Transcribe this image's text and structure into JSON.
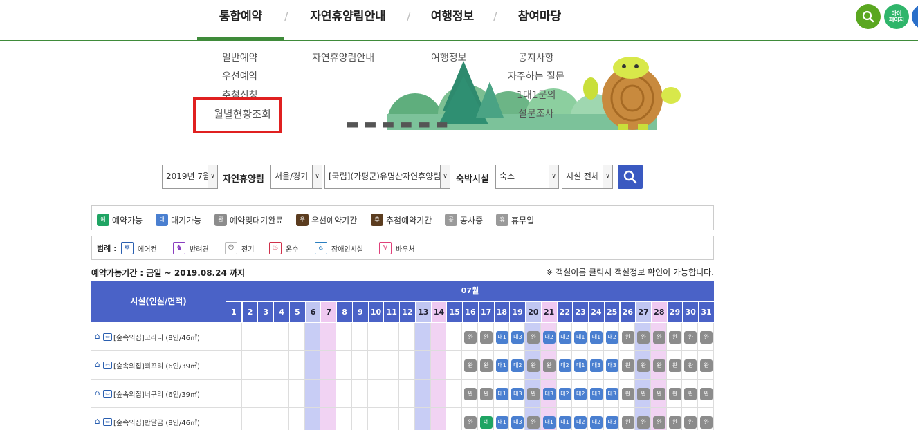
{
  "gnb": {
    "items": [
      {
        "label": "통합예약",
        "active": true
      },
      {
        "label": "자연휴양림안내",
        "active": false
      },
      {
        "label": "여행정보",
        "active": false
      },
      {
        "label": "참여마당",
        "active": false
      }
    ],
    "separator": "/",
    "mypage_label": "마이\n페이지"
  },
  "submenu": {
    "reservation": [
      "일반예약",
      "우선예약",
      "추첨신청",
      "월별현황조회"
    ],
    "forest": [
      "자연휴양림안내"
    ],
    "travel": [
      "여행정보"
    ],
    "community": [
      "공지사항",
      "자주하는 질문",
      "1대1문의",
      "설문조사"
    ]
  },
  "filters": {
    "month": "2019년 7월",
    "forest_label": "자연휴양림",
    "region": "서울/경기",
    "forest": "[국립](가평군)유명산자연휴양림",
    "lodging_label": "숙박시설",
    "lodging": "숙소",
    "facility": "시설 전체"
  },
  "status_legend": [
    {
      "icon": "예",
      "label": "예약가능",
      "color": "#1fa463"
    },
    {
      "icon": "대",
      "label": "대기가능",
      "color": "#4a7fd0"
    },
    {
      "icon": "완",
      "label": "예약및대기완료",
      "color": "#8c8c8c"
    },
    {
      "icon": "우",
      "label": "우선예약기간",
      "color": "#5b3c1f"
    },
    {
      "icon": "추",
      "label": "추첨예약기간",
      "color": "#5b3c1f"
    },
    {
      "icon": "공",
      "label": "공사중",
      "color": "#9a9a9a"
    },
    {
      "icon": "휴",
      "label": "휴무일",
      "color": "#9a9a9a"
    }
  ],
  "amenity_legend": {
    "title": "범례 :",
    "items": [
      {
        "label": "에어컨",
        "icon": "aircon-icon",
        "glyph": "❄",
        "color": "#2a5fb0"
      },
      {
        "label": "반려견",
        "icon": "pet-icon",
        "glyph": "🐕",
        "color": "#8a3fc0"
      },
      {
        "label": "전기",
        "icon": "electric-icon",
        "glyph": "⏻",
        "color": "#666666"
      },
      {
        "label": "온수",
        "icon": "hotwater-icon",
        "glyph": "♨",
        "color": "#d0304a"
      },
      {
        "label": "장애인시설",
        "icon": "accessible-icon",
        "glyph": "♿",
        "color": "#2a7fc0"
      },
      {
        "label": "바우처",
        "icon": "voucher-icon",
        "glyph": "V",
        "color": "#e0407a"
      }
    ]
  },
  "period": "예약가능기간 : 금일 ~ 2019.08.24 까지",
  "note": "※ 객실이름 클릭시 객실정보 확인이 가능합니다.",
  "calendar": {
    "facility_header": "시설(인실/면적)",
    "month": "07월",
    "days": [
      "1",
      "2",
      "3",
      "4",
      "5",
      "6",
      "7",
      "8",
      "9",
      "10",
      "11",
      "12",
      "13",
      "14",
      "15",
      "16",
      "17",
      "18",
      "19",
      "20",
      "21",
      "22",
      "23",
      "24",
      "25",
      "26",
      "27",
      "28",
      "29",
      "30",
      "31"
    ],
    "saturdays": [
      6,
      13,
      20,
      27
    ],
    "sundays": [
      7,
      14,
      21,
      28
    ],
    "status_colors": {
      "완": "#8c8c8c",
      "예": "#1fa463",
      "대1": "#4a7fd0",
      "대2": "#4a7fd0",
      "대3": "#4a7fd0"
    },
    "rows": [
      {
        "name": "[숲속의집]고라니 (8인/46㎡)",
        "statuses": [
          "완",
          "완",
          "대1",
          "대3",
          "완",
          "대2",
          "대2",
          "대1",
          "대1",
          "대2",
          "완",
          "완",
          "완",
          "완",
          "완",
          "완"
        ]
      },
      {
        "name": "[숲속의집]꾀꼬리 (6인/39㎡)",
        "statuses": [
          "완",
          "완",
          "대1",
          "대2",
          "완",
          "완",
          "대2",
          "대1",
          "대3",
          "대3",
          "완",
          "완",
          "완",
          "완",
          "완",
          "완"
        ]
      },
      {
        "name": "[숲속의집]너구리 (6인/39㎡)",
        "statuses": [
          "완",
          "완",
          "대1",
          "대3",
          "완",
          "대3",
          "대2",
          "대2",
          "대3",
          "대3",
          "완",
          "완",
          "완",
          "완",
          "완",
          "완"
        ]
      },
      {
        "name": "[숲속의집]반달곰 (8인/46㎡)",
        "statuses": [
          "완",
          "예",
          "대1",
          "대3",
          "완",
          "대1",
          "대1",
          "대2",
          "대2",
          "대3",
          "완",
          "완",
          "완",
          "완",
          "완",
          "완"
        ]
      }
    ]
  }
}
